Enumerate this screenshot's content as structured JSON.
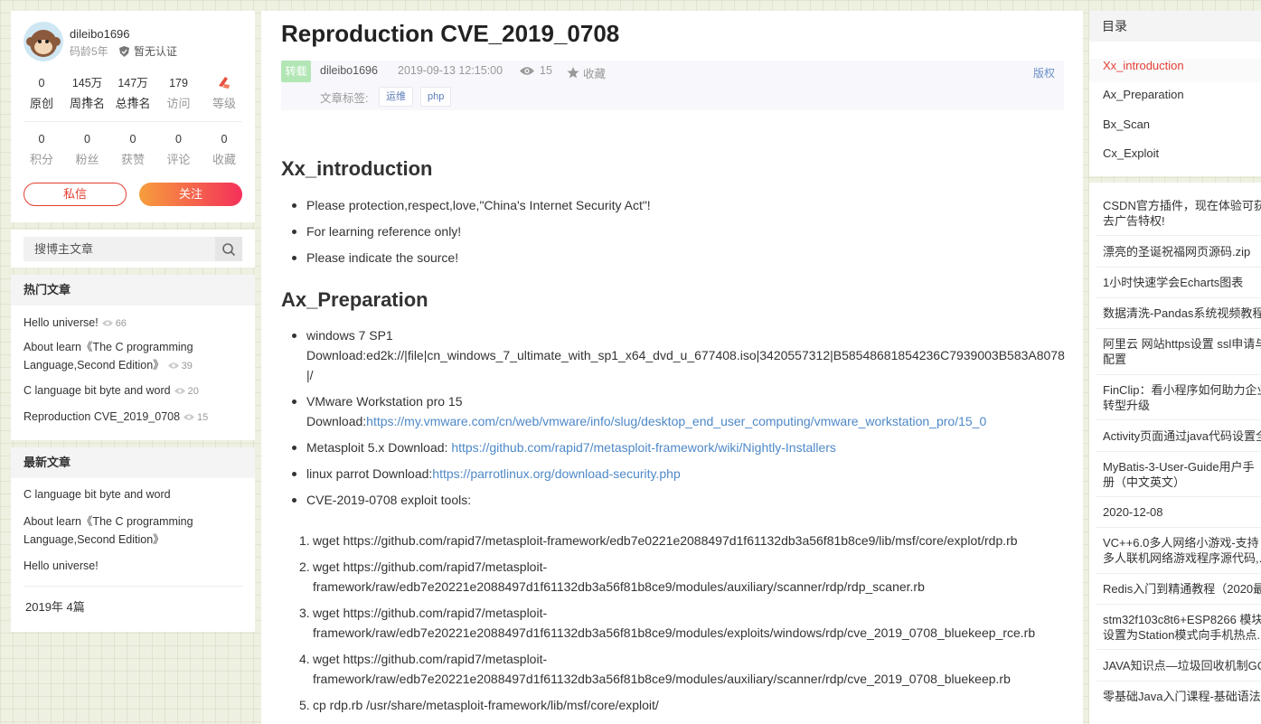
{
  "profile": {
    "username": "dileibo1696",
    "code_age": "码龄5年",
    "cert": "暂无认证",
    "stats_top": [
      {
        "value": "0",
        "label": "原创"
      },
      {
        "value": "145万+",
        "label": "周排名"
      },
      {
        "value": "147万+",
        "label": "总排名"
      },
      {
        "value": "179",
        "label": "访问"
      },
      {
        "value": "",
        "label": "等级"
      }
    ],
    "stats_bottom": [
      {
        "value": "0",
        "label": "积分"
      },
      {
        "value": "0",
        "label": "粉丝"
      },
      {
        "value": "0",
        "label": "获赞"
      },
      {
        "value": "0",
        "label": "评论"
      },
      {
        "value": "0",
        "label": "收藏"
      }
    ],
    "message_label": "私信",
    "follow_label": "关注"
  },
  "search": {
    "placeholder": "搜博主文章"
  },
  "hot": {
    "title": "热门文章",
    "items": [
      {
        "title": "Hello universe!",
        "views": "66"
      },
      {
        "title": "About learn《The C programming Language,Second Edition》",
        "views": "39"
      },
      {
        "title": "C language bit byte and word",
        "views": "20"
      },
      {
        "title": "Reproduction CVE_2019_0708",
        "views": "15"
      }
    ]
  },
  "latest": {
    "title": "最新文章",
    "items": [
      {
        "title": "C language bit byte and word"
      },
      {
        "title": "About learn《The C programming Language,Second Edition》"
      },
      {
        "title": "Hello universe!"
      }
    ],
    "archive": "2019年  4篇"
  },
  "article": {
    "title": "Reproduction CVE_2019_0708",
    "badge": "转载",
    "author": "dileibo1696",
    "time": "2019-09-13 12:15:00",
    "views": "15",
    "favorite": "收藏",
    "copyright": "版权",
    "tags_label": "文章标签:",
    "tags": [
      "运维",
      "php"
    ],
    "sections": {
      "intro_heading": "Xx_introduction",
      "intro_items": [
        "Please protection,respect,love,\"China's Internet Security Act\"!",
        "For learning reference only!",
        "Please indicate the source!"
      ],
      "prep_heading": "Ax_Preparation",
      "prep": {
        "win_line1": "windows 7 SP1",
        "win_line2": "Download:ed2k://|file|cn_windows_7_ultimate_with_sp1_x64_dvd_u_677408.iso|3420557312|B58548681854236C7939003B583A8078|/",
        "vmware_line1": "VMware Workstation pro 15",
        "vmware_prefix": "Download:",
        "vmware_link": "https://my.vmware.com/cn/web/vmware/info/slug/desktop_end_user_computing/vmware_workstation_pro/15_0",
        "msf_prefix": "Metasploit 5.x Download: ",
        "msf_link": "https://github.com/rapid7/metasploit-framework/wiki/Nightly-Installers",
        "parrot_prefix": "linux parrot Download:",
        "parrot_link": "https://parrotlinux.org/download-security.php",
        "tools": "CVE-2019-0708 exploit tools:"
      },
      "steps": [
        "wget https://github.com/rapid7/metasploit-framework/edb7e0221e2088497d1f61132db3a56f81b8ce9/lib/msf/core/explot/rdp.rb",
        "wget https://github.com/rapid7/metasploit-framework/raw/edb7e20221e2088497d1f61132db3a56f81b8ce9/modules/auxiliary/scanner/rdp/rdp_scaner.rb",
        "wget https://github.com/rapid7/metasploit-framework/raw/edb7e20221e2088497d1f61132db3a56f81b8ce9/modules/exploits/windows/rdp/cve_2019_0708_bluekeep_rce.rb",
        "wget https://github.com/rapid7/metasploit-framework/raw/edb7e20221e2088497d1f61132db3a56f81b8ce9/modules/auxiliary/scanner/rdp/cve_2019_0708_bluekeep.rb",
        "cp rdp.rb /usr/share/metasploit-framework/lib/msf/core/exploit/"
      ]
    }
  },
  "toc": {
    "title": "目录",
    "items": [
      "Xx_introduction",
      "Ax_Preparation",
      "Bx_Scan",
      "Cx_Exploit"
    ]
  },
  "recommend": {
    "items": [
      [
        "CSDN官方插件，现在体验可获",
        "去广告特权!"
      ],
      [
        "漂亮的圣诞祝福网页源码.zip"
      ],
      [
        "1小时快速学会Echarts图表"
      ],
      [
        "数据清洗-Pandas系统视频教程"
      ],
      [
        "阿里云 网站https设置 ssl申请与",
        "配置"
      ],
      [
        "FinClip：看小程序如何助力企业",
        "转型升级"
      ],
      [
        "Activity页面通过java代码设置全"
      ],
      [
        "MyBatis-3-User-Guide用户手",
        "册（中文英文）"
      ],
      [
        "2020-12-08"
      ],
      [
        "VC++6.0多人网络小游戏-支持",
        "多人联机网络游戏程序源代码,..."
      ],
      [
        "Redis入门到精通教程（2020最"
      ],
      [
        "stm32f103c8t6+ESP8266 模块",
        "设置为Station模式向手机热点..."
      ],
      [
        "JAVA知识点—垃圾回收机制GC"
      ],
      [
        "零基础Java入门课程-基础语法"
      ]
    ]
  },
  "colors": {
    "accent_red": "#e33e33",
    "link_blue": "#4e88c7",
    "repost_green": "#b2e6b4"
  }
}
